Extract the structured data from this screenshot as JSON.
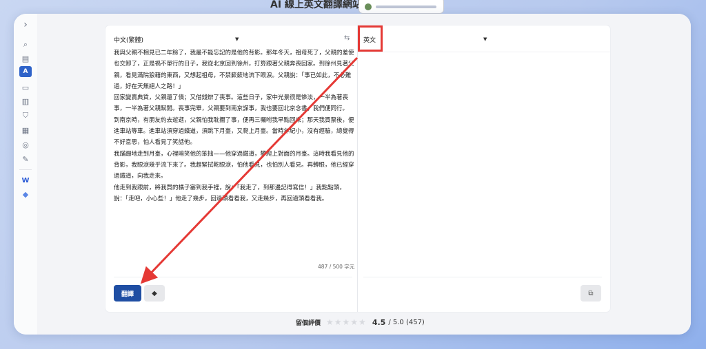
{
  "header": {
    "title": "AI 線上英文翻譯網站"
  },
  "sidebar": {
    "items": [
      {
        "icon": "chevron-right-icon",
        "glyph": "›"
      },
      {
        "icon": "search-doc-icon",
        "glyph": "⌕"
      },
      {
        "icon": "document-icon",
        "glyph": "▤"
      },
      {
        "icon": "translate-icon",
        "glyph": "A"
      },
      {
        "icon": "chat-icon",
        "glyph": "▭"
      },
      {
        "icon": "clipboard-icon",
        "glyph": "▥"
      },
      {
        "icon": "shield-icon",
        "glyph": "⛉"
      },
      {
        "icon": "pages-icon",
        "glyph": "▦"
      },
      {
        "icon": "chat-bubbles-icon",
        "glyph": "◎"
      },
      {
        "icon": "edit-icon",
        "glyph": "✎"
      },
      {
        "icon": "word-icon",
        "glyph": "W"
      },
      {
        "icon": "gem-icon",
        "glyph": "◆"
      }
    ]
  },
  "translator": {
    "source_language": "中文(繁體)",
    "target_language": "英文",
    "source_text": "我與父親不相見已二年餘了，我最不能忘記的是他的背影。那年冬天，祖母死了，父親的差使也交卸了，正是禍不單行的日子，我從北京回到徐州，打算跟著父親奔喪回家。到徐州見著父親，看見滿院狼藉的東西，又想起祖母，不禁簌簌地流下眼淚。父親說：「事已如此，不必難過，好在天無絕人之路！」\n回家變賣典質，父親還了債；又借錢辦了喪事。這些日子，家中光景很是慘淡，一半為著喪事，一半為著父親賦閒。喪事完畢，父親要到南京謀事，我也要回北京念書，我們便同行。\n到南京時，有朋友約去遊逛，父親怕我耽擱了事，便再三囑咐我早點回來；那天我買票後，便進車站等車。進車站須穿過鐵道，須跳下月臺，又爬上月臺。當時年紀小，沒有經驗，總覺得不好意思，怕人看見了笑話他。\n我蹣跚地走到月臺，心裡暗笑他的笨拙——他穿過鐵道，攀爬上對面的月臺。這時我看見他的背影，我眼淚幾乎流下來了。我趕緊拭乾眼淚，怕他看見，也怕別人看見。再轉眼，他已經穿過鐵道，向我走來。\n他走到我跟前，將我買的橘子塞到我手裡，說：「我走了，到那邊記得寫信！」我點點頭，說：「走吧，小心些！」他走了幾步，回過頭看看我，又走幾步，再回過頭看看我。",
    "char_count": "487 / 500 字元",
    "translate_label": "翻譯",
    "clear_icon": "eraser-icon",
    "copy_icon": "copy-icon",
    "swap_icon": "swap-icon"
  },
  "rating": {
    "label": "留個評價",
    "score": "4.5",
    "rest": "/ 5.0 (457)",
    "stars": "★★★★★"
  },
  "annotation": {
    "color": "#e53935"
  }
}
